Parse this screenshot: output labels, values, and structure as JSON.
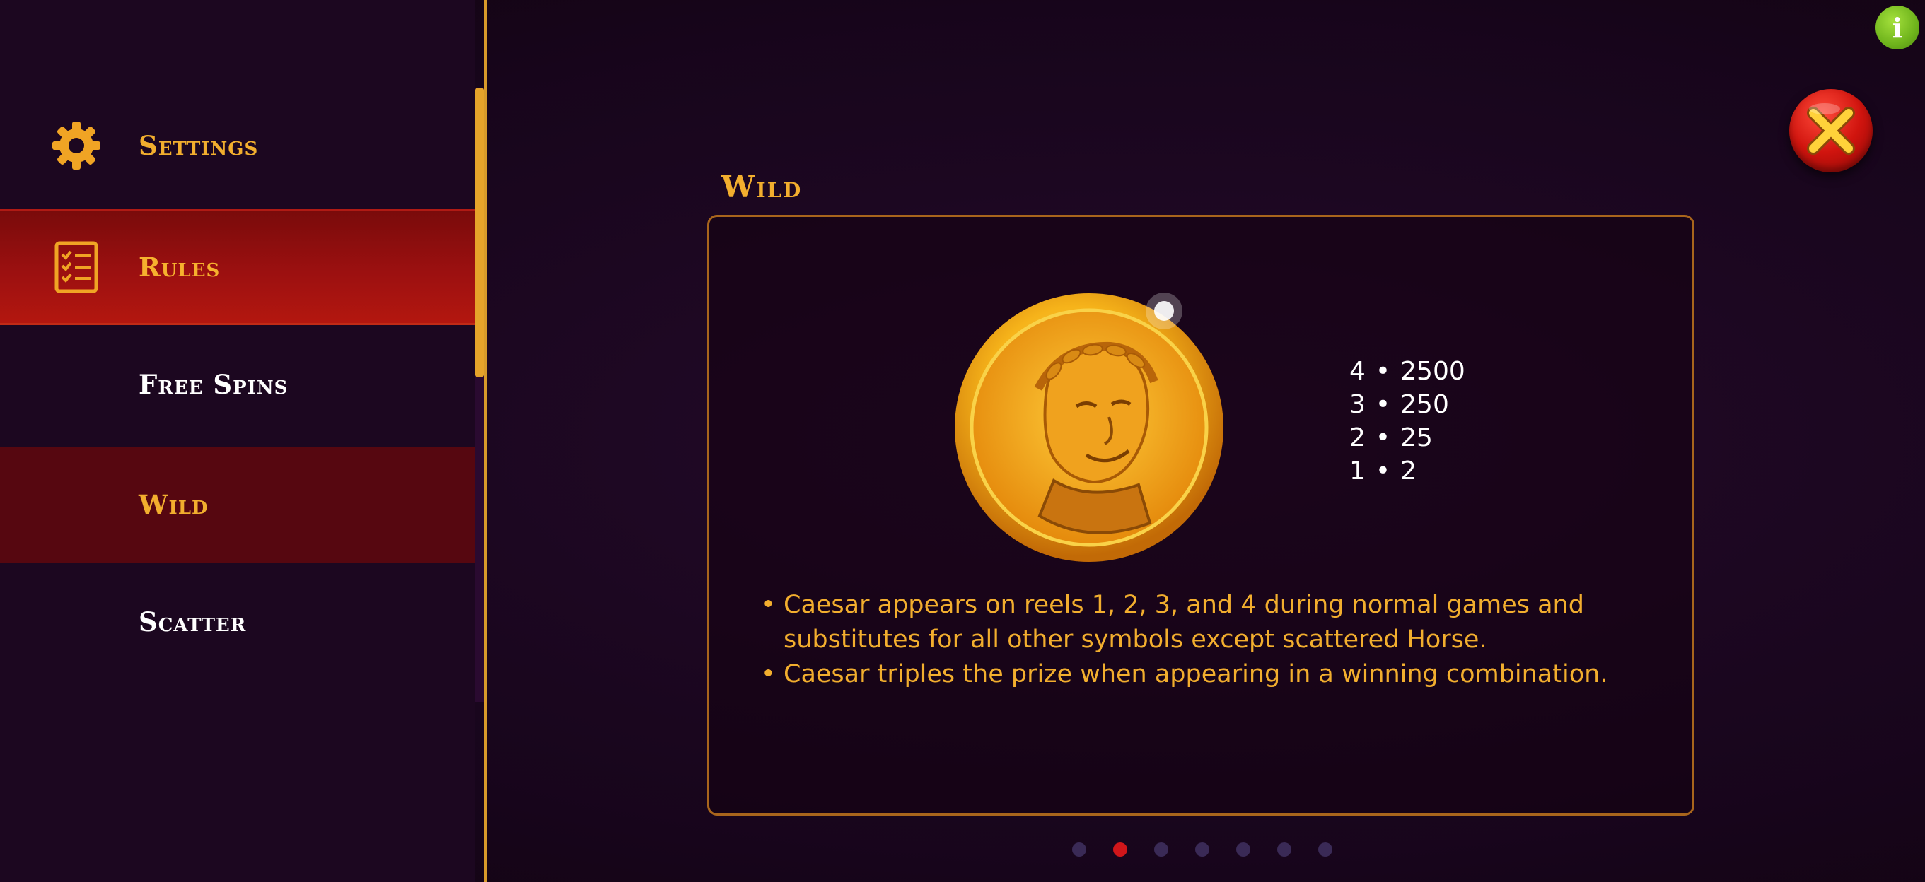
{
  "sidebar": {
    "items": [
      {
        "label": "Settings",
        "icon": "gear-icon"
      },
      {
        "label": "Rules",
        "icon": "checklist-icon"
      },
      {
        "label": "Free Spins"
      },
      {
        "label": "Wild"
      },
      {
        "label": "Scatter"
      }
    ]
  },
  "header": {
    "info_label": "i"
  },
  "section": {
    "title": "Wild",
    "symbol": "caesar-coin",
    "payouts": [
      {
        "count": "4",
        "sep": "•",
        "value": "2500"
      },
      {
        "count": "3",
        "sep": "•",
        "value": "250"
      },
      {
        "count": "2",
        "sep": "•",
        "value": "25"
      },
      {
        "count": "1",
        "sep": "•",
        "value": "2"
      }
    ],
    "rules": [
      {
        "bullet": "•",
        "text": "Caesar appears on reels 1, 2, 3, and 4 during normal games and substitutes for all other symbols except scattered Horse."
      },
      {
        "bullet": "•",
        "text": "Caesar triples the prize when appearing in a winning combination."
      }
    ]
  },
  "pagination": {
    "total": 7,
    "current": 2
  },
  "colors": {
    "accent_gold": "#f2ae2e",
    "active_red": "#9c1010",
    "info_green": "#6fb41c",
    "close_red": "#d0140e"
  }
}
